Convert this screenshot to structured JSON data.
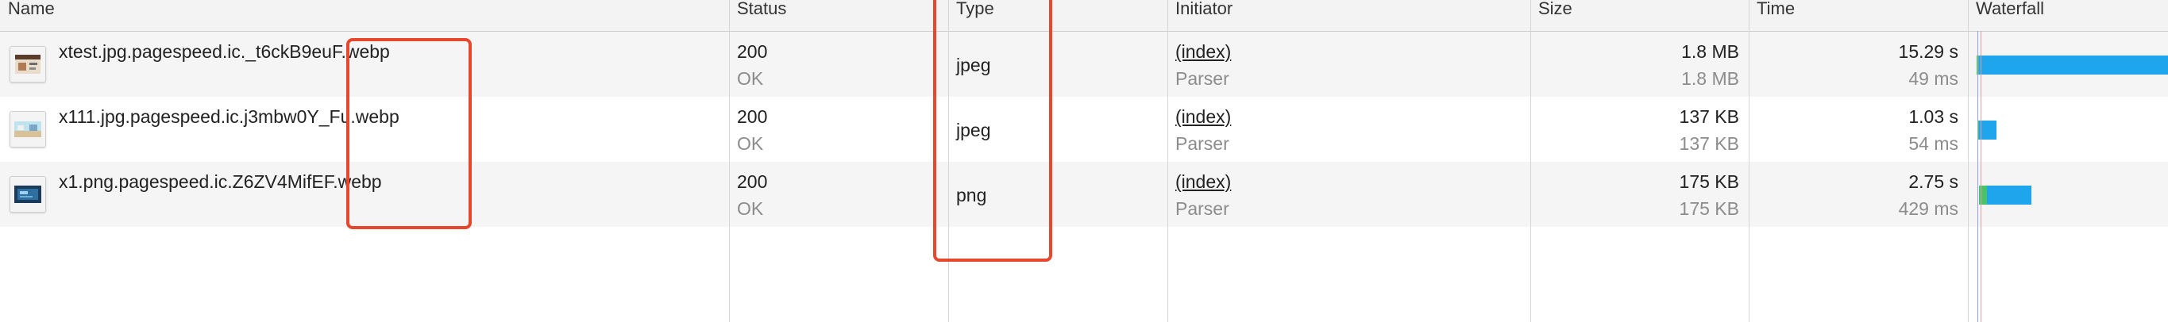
{
  "columns": {
    "name": "Name",
    "status": "Status",
    "type": "Type",
    "initiator": "Initiator",
    "size": "Size",
    "time": "Time",
    "waterfall": "Waterfall"
  },
  "requests": [
    {
      "name": "xtest.jpg.pagespeed.ic._t6ckB9euF.webp",
      "status_code": "200",
      "status_text": "OK",
      "type": "jpeg",
      "initiator": "(index)",
      "initiator_kind": "Parser",
      "size": "1.8 MB",
      "size_resource": "1.8 MB",
      "time": "15.29 s",
      "latency": "49 ms",
      "thumb_icon": "image-thumbnail-icon"
    },
    {
      "name": "x111.jpg.pagespeed.ic.j3mbw0Y_Fu.webp",
      "status_code": "200",
      "status_text": "OK",
      "type": "jpeg",
      "initiator": "(index)",
      "initiator_kind": "Parser",
      "size": "137 KB",
      "size_resource": "137 KB",
      "time": "1.03 s",
      "latency": "54 ms",
      "thumb_icon": "image-thumbnail-icon"
    },
    {
      "name": "x1.png.pagespeed.ic.Z6ZV4MifEF.webp",
      "status_code": "200",
      "status_text": "OK",
      "type": "png",
      "initiator": "(index)",
      "initiator_kind": "Parser",
      "size": "175 KB",
      "size_resource": "175 KB",
      "time": "2.75 s",
      "latency": "429 ms",
      "thumb_icon": "image-thumbnail-icon"
    }
  ],
  "colors": {
    "waterfall_receiving": "#1ea5ec",
    "waterfall_waiting": "#49c36a",
    "annotation_box": "#e6472d"
  }
}
